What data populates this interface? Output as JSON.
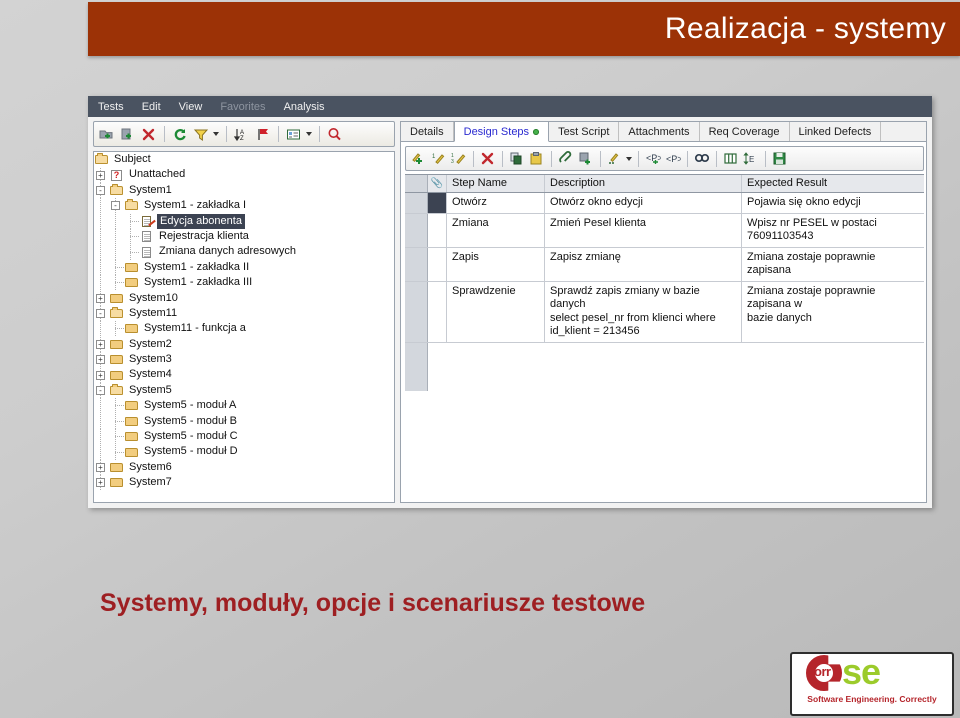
{
  "slide": {
    "title": "Realizacja - systemy",
    "caption": "Systemy, moduły, opcje i scenariusze testowe",
    "title_bg": "#9c3206",
    "caption_color": "#9e1f22"
  },
  "app": {
    "menu": [
      {
        "label": "Tests",
        "enabled": true
      },
      {
        "label": "Edit",
        "enabled": true
      },
      {
        "label": "View",
        "enabled": true
      },
      {
        "label": "Favorites",
        "enabled": false
      },
      {
        "label": "Analysis",
        "enabled": true
      }
    ],
    "tree_toolbar": [
      {
        "name": "new-folder-icon"
      },
      {
        "name": "new-test-icon"
      },
      {
        "name": "delete-icon"
      },
      {
        "name": "refresh-icon"
      },
      {
        "name": "filter-icon"
      },
      {
        "name": "sort-az-icon"
      },
      {
        "name": "flag-icon"
      },
      {
        "name": "details-icon"
      },
      {
        "name": "find-icon"
      }
    ],
    "tree": [
      {
        "depth": 0,
        "label": "Subject",
        "icon": "folder-open",
        "expander": "",
        "selected": false
      },
      {
        "depth": 1,
        "label": "Unattached",
        "icon": "unattached",
        "expander": "+",
        "selected": false
      },
      {
        "depth": 1,
        "label": "System1",
        "icon": "folder-open",
        "expander": "-",
        "selected": false
      },
      {
        "depth": 2,
        "label": "System1 - zakładka I",
        "icon": "folder-open",
        "expander": "-",
        "selected": false
      },
      {
        "depth": 3,
        "label": "Edycja abonenta",
        "icon": "doc-edited",
        "expander": "",
        "selected": true
      },
      {
        "depth": 3,
        "label": "Rejestracja klienta",
        "icon": "doc",
        "expander": "",
        "selected": false
      },
      {
        "depth": 3,
        "label": "Zmiana danych adresowych",
        "icon": "doc",
        "expander": "",
        "selected": false
      },
      {
        "depth": 2,
        "label": "System1 - zakładka II",
        "icon": "folder",
        "expander": "",
        "selected": false
      },
      {
        "depth": 2,
        "label": "System1 - zakładka III",
        "icon": "folder",
        "expander": "",
        "selected": false
      },
      {
        "depth": 1,
        "label": "System10",
        "icon": "folder",
        "expander": "+",
        "selected": false
      },
      {
        "depth": 1,
        "label": "System11",
        "icon": "folder-open",
        "expander": "-",
        "selected": false
      },
      {
        "depth": 2,
        "label": "System11 - funkcja a",
        "icon": "folder",
        "expander": "",
        "selected": false
      },
      {
        "depth": 1,
        "label": "System2",
        "icon": "folder",
        "expander": "+",
        "selected": false
      },
      {
        "depth": 1,
        "label": "System3",
        "icon": "folder",
        "expander": "+",
        "selected": false
      },
      {
        "depth": 1,
        "label": "System4",
        "icon": "folder",
        "expander": "+",
        "selected": false
      },
      {
        "depth": 1,
        "label": "System5",
        "icon": "folder-open",
        "expander": "-",
        "selected": false
      },
      {
        "depth": 2,
        "label": "System5 - moduł A",
        "icon": "folder",
        "expander": "",
        "selected": false
      },
      {
        "depth": 2,
        "label": "System5 - moduł B",
        "icon": "folder",
        "expander": "",
        "selected": false
      },
      {
        "depth": 2,
        "label": "System5 - moduł C",
        "icon": "folder",
        "expander": "",
        "selected": false
      },
      {
        "depth": 2,
        "label": "System5 - moduł D",
        "icon": "folder",
        "expander": "",
        "selected": false
      },
      {
        "depth": 1,
        "label": "System6",
        "icon": "folder",
        "expander": "+",
        "selected": false
      },
      {
        "depth": 1,
        "label": "System7",
        "icon": "folder",
        "expander": "+",
        "selected": false
      }
    ],
    "tabs": [
      {
        "label": "Details",
        "active": false,
        "dot": false
      },
      {
        "label": "Design Steps",
        "active": true,
        "dot": true
      },
      {
        "label": "Test Script",
        "active": false,
        "dot": false
      },
      {
        "label": "Attachments",
        "active": false,
        "dot": false
      },
      {
        "label": "Req Coverage",
        "active": false,
        "dot": false
      },
      {
        "label": "Linked Defects",
        "active": false,
        "dot": false
      }
    ],
    "grid_toolbar": [
      {
        "name": "add-step-icon"
      },
      {
        "name": "add-step-after-icon"
      },
      {
        "name": "renumber-steps-icon"
      },
      {
        "name": "delete-step-icon"
      },
      {
        "name": "copy-icon"
      },
      {
        "name": "paste-icon"
      },
      {
        "name": "attachment-icon"
      },
      {
        "name": "add-attachment-icon"
      },
      {
        "name": "call-test-icon"
      },
      {
        "name": "add-parameter-icon"
      },
      {
        "name": "parameter-icon"
      },
      {
        "name": "find-icon"
      },
      {
        "name": "columns-icon"
      },
      {
        "name": "row-height-icon"
      },
      {
        "name": "save-icon"
      }
    ],
    "grid": {
      "columns": [
        "Step Name",
        "Description",
        "Expected Result"
      ],
      "attachment_column_icon": "paperclip-icon",
      "rows": [
        {
          "selected": true,
          "step_name": [
            "Otwórz"
          ],
          "description": [
            "Otwórz okno edycji"
          ],
          "expected": [
            "Pojawia się okno edycji"
          ]
        },
        {
          "selected": false,
          "step_name": [
            "Zmiana"
          ],
          "description": [
            "Zmień Pesel klienta"
          ],
          "expected": [
            "Wpisz nr PESEL w postaci",
            "76091103543"
          ]
        },
        {
          "selected": false,
          "step_name": [
            "Zapis"
          ],
          "description": [
            "Zapisz zmianę"
          ],
          "expected": [
            "Zmiana zostaje poprawnie zapisana"
          ]
        },
        {
          "selected": false,
          "step_name": [
            "Sprawdzenie"
          ],
          "description": [
            "Sprawdź zapis zmiany w bazie danych",
            "select pesel_nr from klienci where",
            "id_klient = 213456"
          ],
          "expected": [
            "Zmiana zostaje poprawnie zapisana w",
            "bazie danych"
          ]
        }
      ]
    }
  },
  "logo": {
    "letters_orr": "orr",
    "letters_se": "se",
    "tagline": "Software Engineering. Correctly",
    "red": "#b5252b",
    "green": "#9ccb2b"
  }
}
